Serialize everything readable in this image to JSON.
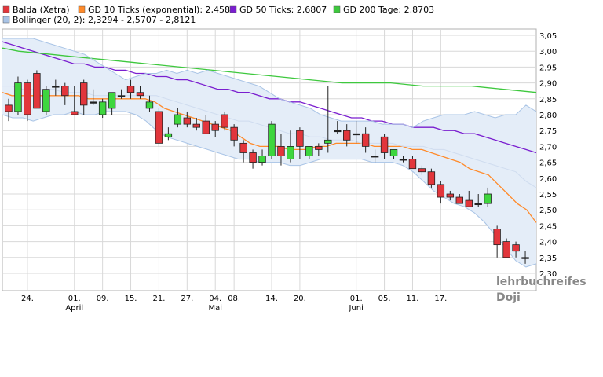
{
  "legend": [
    {
      "label": "Balda (Xetra)",
      "color": "#e2363c"
    },
    {
      "label": "GD 10 Ticks (exponential): 2,4582",
      "color": "#ff8a2a"
    },
    {
      "label": "GD 50 Ticks: 2,6807",
      "color": "#7a1ecf"
    },
    {
      "label": "GD 200 Tage: 2,8703",
      "color": "#3ec83e"
    },
    {
      "label": "Bollinger (20, 2): 2,3294 - 2,5707 - 2,8121",
      "color": "#a9c4e6"
    }
  ],
  "watermark": {
    "line1": "lehrbuchreifes",
    "line2": "Doji"
  },
  "chart_data": {
    "type": "candlestick",
    "ylim": [
      2.3,
      3.05
    ],
    "yticks": [
      "3,05",
      "3,00",
      "2,95",
      "2,90",
      "2,85",
      "2,80",
      "2,75",
      "2,70",
      "2,65",
      "2,60",
      "2,55",
      "2,50",
      "2,45",
      "2,40",
      "2,35",
      "2,30"
    ],
    "xticks": [
      {
        "label": "24.",
        "i": 2
      },
      {
        "label": "01.",
        "i": 7
      },
      {
        "label": "09.",
        "i": 10
      },
      {
        "label": "15.",
        "i": 13
      },
      {
        "label": "21.",
        "i": 16
      },
      {
        "label": "27.",
        "i": 19
      },
      {
        "label": "04.",
        "i": 22
      },
      {
        "label": "08.",
        "i": 24
      },
      {
        "label": "14.",
        "i": 28
      },
      {
        "label": "20.",
        "i": 31
      },
      {
        "label": "01.",
        "i": 37
      },
      {
        "label": "05.",
        "i": 40
      },
      {
        "label": "11.",
        "i": 43
      },
      {
        "label": "17.",
        "i": 46
      }
    ],
    "month_labels": [
      {
        "label": "April",
        "i": 7
      },
      {
        "label": "Mai",
        "i": 22
      },
      {
        "label": "Juni",
        "i": 37
      }
    ],
    "candles": [
      {
        "o": 2.83,
        "h": 2.85,
        "l": 2.78,
        "c": 2.81
      },
      {
        "o": 2.81,
        "h": 2.92,
        "l": 2.8,
        "c": 2.9
      },
      {
        "o": 2.9,
        "h": 2.91,
        "l": 2.78,
        "c": 2.8
      },
      {
        "o": 2.93,
        "h": 2.94,
        "l": 2.82,
        "c": 2.82
      },
      {
        "o": 2.81,
        "h": 2.89,
        "l": 2.8,
        "c": 2.88
      },
      {
        "o": 2.89,
        "h": 2.91,
        "l": 2.86,
        "c": 2.89
      },
      {
        "o": 2.89,
        "h": 2.9,
        "l": 2.83,
        "c": 2.86
      },
      {
        "o": 2.81,
        "h": 2.89,
        "l": 2.8,
        "c": 2.8
      },
      {
        "o": 2.9,
        "h": 2.91,
        "l": 2.8,
        "c": 2.83
      },
      {
        "o": 2.84,
        "h": 2.88,
        "l": 2.83,
        "c": 2.84
      },
      {
        "o": 2.8,
        "h": 2.85,
        "l": 2.79,
        "c": 2.84
      },
      {
        "o": 2.82,
        "h": 2.87,
        "l": 2.8,
        "c": 2.87
      },
      {
        "o": 2.86,
        "h": 2.88,
        "l": 2.85,
        "c": 2.86
      },
      {
        "o": 2.89,
        "h": 2.91,
        "l": 2.85,
        "c": 2.87
      },
      {
        "o": 2.87,
        "h": 2.89,
        "l": 2.85,
        "c": 2.86
      },
      {
        "o": 2.82,
        "h": 2.86,
        "l": 2.81,
        "c": 2.84
      },
      {
        "o": 2.81,
        "h": 2.82,
        "l": 2.7,
        "c": 2.71
      },
      {
        "o": 2.73,
        "h": 2.76,
        "l": 2.72,
        "c": 2.74
      },
      {
        "o": 2.77,
        "h": 2.82,
        "l": 2.76,
        "c": 2.8
      },
      {
        "o": 2.79,
        "h": 2.81,
        "l": 2.76,
        "c": 2.77
      },
      {
        "o": 2.77,
        "h": 2.79,
        "l": 2.75,
        "c": 2.76
      },
      {
        "o": 2.78,
        "h": 2.8,
        "l": 2.74,
        "c": 2.74
      },
      {
        "o": 2.77,
        "h": 2.78,
        "l": 2.73,
        "c": 2.75
      },
      {
        "o": 2.8,
        "h": 2.81,
        "l": 2.75,
        "c": 2.76
      },
      {
        "o": 2.76,
        "h": 2.77,
        "l": 2.7,
        "c": 2.72
      },
      {
        "o": 2.71,
        "h": 2.72,
        "l": 2.65,
        "c": 2.68
      },
      {
        "o": 2.68,
        "h": 2.69,
        "l": 2.63,
        "c": 2.65
      },
      {
        "o": 2.65,
        "h": 2.69,
        "l": 2.64,
        "c": 2.67
      },
      {
        "o": 2.67,
        "h": 2.78,
        "l": 2.66,
        "c": 2.77
      },
      {
        "o": 2.7,
        "h": 2.74,
        "l": 2.64,
        "c": 2.67
      },
      {
        "o": 2.66,
        "h": 2.75,
        "l": 2.65,
        "c": 2.7
      },
      {
        "o": 2.75,
        "h": 2.76,
        "l": 2.66,
        "c": 2.7
      },
      {
        "o": 2.67,
        "h": 2.7,
        "l": 2.66,
        "c": 2.7
      },
      {
        "o": 2.7,
        "h": 2.71,
        "l": 2.67,
        "c": 2.69
      },
      {
        "o": 2.71,
        "h": 2.89,
        "l": 2.68,
        "c": 2.72
      },
      {
        "o": 2.75,
        "h": 2.78,
        "l": 2.74,
        "c": 2.75
      },
      {
        "o": 2.75,
        "h": 2.77,
        "l": 2.7,
        "c": 2.72
      },
      {
        "o": 2.74,
        "h": 2.78,
        "l": 2.71,
        "c": 2.74
      },
      {
        "o": 2.74,
        "h": 2.76,
        "l": 2.68,
        "c": 2.7
      },
      {
        "o": 2.67,
        "h": 2.69,
        "l": 2.65,
        "c": 2.67
      },
      {
        "o": 2.73,
        "h": 2.74,
        "l": 2.66,
        "c": 2.68
      },
      {
        "o": 2.67,
        "h": 2.69,
        "l": 2.66,
        "c": 2.69
      },
      {
        "o": 2.66,
        "h": 2.67,
        "l": 2.65,
        "c": 2.66
      },
      {
        "o": 2.66,
        "h": 2.67,
        "l": 2.63,
        "c": 2.63
      },
      {
        "o": 2.63,
        "h": 2.64,
        "l": 2.61,
        "c": 2.62
      },
      {
        "o": 2.62,
        "h": 2.63,
        "l": 2.57,
        "c": 2.58
      },
      {
        "o": 2.58,
        "h": 2.59,
        "l": 2.52,
        "c": 2.54
      },
      {
        "o": 2.55,
        "h": 2.56,
        "l": 2.53,
        "c": 2.54
      },
      {
        "o": 2.54,
        "h": 2.55,
        "l": 2.52,
        "c": 2.52
      },
      {
        "o": 2.53,
        "h": 2.56,
        "l": 2.51,
        "c": 2.51
      },
      {
        "o": 2.52,
        "h": 2.55,
        "l": 2.51,
        "c": 2.52
      },
      {
        "o": 2.52,
        "h": 2.57,
        "l": 2.51,
        "c": 2.55
      },
      {
        "o": 2.44,
        "h": 2.45,
        "l": 2.35,
        "c": 2.39
      },
      {
        "o": 2.4,
        "h": 2.41,
        "l": 2.35,
        "c": 2.35
      },
      {
        "o": 2.39,
        "h": 2.4,
        "l": 2.35,
        "c": 2.37
      },
      {
        "o": 2.35,
        "h": 2.37,
        "l": 2.33,
        "c": 2.35
      }
    ],
    "series": [
      {
        "name": "GD 10 Ticks (exponential)",
        "color": "#ff8a2a",
        "values": [
          2.87,
          2.86,
          2.86,
          2.86,
          2.86,
          2.86,
          2.86,
          2.86,
          2.86,
          2.85,
          2.85,
          2.85,
          2.85,
          2.85,
          2.85,
          2.85,
          2.84,
          2.82,
          2.81,
          2.8,
          2.79,
          2.78,
          2.77,
          2.76,
          2.75,
          2.73,
          2.71,
          2.7,
          2.7,
          2.7,
          2.69,
          2.69,
          2.69,
          2.7,
          2.7,
          2.71,
          2.71,
          2.71,
          2.71,
          2.7,
          2.7,
          2.7,
          2.7,
          2.69,
          2.69,
          2.68,
          2.67,
          2.66,
          2.65,
          2.63,
          2.62,
          2.61,
          2.58,
          2.55,
          2.52,
          2.5,
          2.46
        ]
      },
      {
        "name": "GD 50 Ticks",
        "color": "#7a1ecf",
        "values": [
          3.03,
          3.02,
          3.01,
          3.0,
          2.99,
          2.98,
          2.97,
          2.96,
          2.96,
          2.95,
          2.95,
          2.94,
          2.94,
          2.93,
          2.93,
          2.92,
          2.92,
          2.91,
          2.91,
          2.9,
          2.89,
          2.88,
          2.88,
          2.87,
          2.87,
          2.86,
          2.85,
          2.85,
          2.84,
          2.84,
          2.83,
          2.82,
          2.81,
          2.8,
          2.79,
          2.79,
          2.78,
          2.78,
          2.77,
          2.77,
          2.76,
          2.76,
          2.76,
          2.75,
          2.75,
          2.74,
          2.74,
          2.73,
          2.72,
          2.71,
          2.7,
          2.69,
          2.68
        ]
      },
      {
        "name": "GD 200 Tage",
        "color": "#3ec83e",
        "values": [
          3.01,
          3.0,
          2.995,
          2.99,
          2.985,
          2.98,
          2.975,
          2.97,
          2.965,
          2.96,
          2.955,
          2.95,
          2.945,
          2.94,
          2.935,
          2.93,
          2.925,
          2.92,
          2.915,
          2.91,
          2.905,
          2.9,
          2.9,
          2.9,
          2.9,
          2.895,
          2.89,
          2.89,
          2.89,
          2.89,
          2.885,
          2.88,
          2.875,
          2.87
        ]
      },
      {
        "name": "Bollinger upper",
        "color": "#a9c4e6",
        "values": [
          3.04,
          3.04,
          3.04,
          3.04,
          3.03,
          3.02,
          3.01,
          3.0,
          2.99,
          2.97,
          2.95,
          2.93,
          2.91,
          2.92,
          2.93,
          2.93,
          2.94,
          2.93,
          2.94,
          2.93,
          2.94,
          2.93,
          2.92,
          2.91,
          2.9,
          2.89,
          2.87,
          2.85,
          2.84,
          2.83,
          2.82,
          2.8,
          2.79,
          2.78,
          2.78,
          2.78,
          2.78,
          2.77,
          2.77,
          2.77,
          2.76,
          2.78,
          2.79,
          2.8,
          2.8,
          2.8,
          2.81,
          2.8,
          2.79,
          2.8,
          2.8,
          2.83,
          2.81
        ]
      },
      {
        "name": "Bollinger mid",
        "color": "#cfdcef",
        "values": [
          2.89,
          2.89,
          2.88,
          2.88,
          2.88,
          2.88,
          2.87,
          2.87,
          2.87,
          2.86,
          2.86,
          2.86,
          2.86,
          2.86,
          2.86,
          2.86,
          2.85,
          2.84,
          2.83,
          2.82,
          2.81,
          2.8,
          2.79,
          2.78,
          2.78,
          2.77,
          2.76,
          2.75,
          2.74,
          2.74,
          2.73,
          2.73,
          2.72,
          2.72,
          2.72,
          2.71,
          2.71,
          2.71,
          2.71,
          2.7,
          2.7,
          2.7,
          2.69,
          2.69,
          2.68,
          2.67,
          2.66,
          2.65,
          2.64,
          2.63,
          2.62,
          2.59,
          2.57
        ]
      },
      {
        "name": "Bollinger lower",
        "color": "#a9c4e6",
        "values": [
          2.8,
          2.79,
          2.79,
          2.78,
          2.79,
          2.8,
          2.8,
          2.81,
          2.8,
          2.8,
          2.81,
          2.81,
          2.81,
          2.8,
          2.78,
          2.75,
          2.73,
          2.72,
          2.71,
          2.7,
          2.69,
          2.68,
          2.67,
          2.66,
          2.66,
          2.65,
          2.65,
          2.65,
          2.64,
          2.64,
          2.65,
          2.66,
          2.66,
          2.66,
          2.66,
          2.66,
          2.65,
          2.65,
          2.65,
          2.64,
          2.62,
          2.59,
          2.56,
          2.54,
          2.52,
          2.51,
          2.49,
          2.46,
          2.42,
          2.38,
          2.34,
          2.32,
          2.33
        ]
      }
    ]
  }
}
